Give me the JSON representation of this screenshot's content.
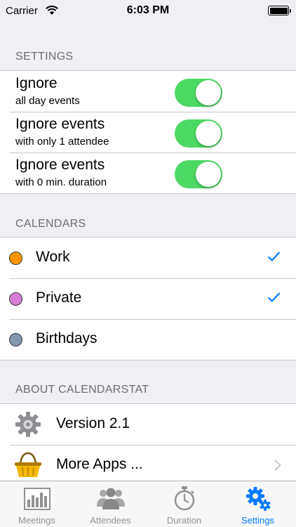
{
  "status_bar": {
    "carrier": "Carrier",
    "time": "6:03 PM"
  },
  "settings": {
    "header": "SETTINGS",
    "items": [
      {
        "title": "Ignore",
        "subtitle": "all day events",
        "on": true
      },
      {
        "title": "Ignore events",
        "subtitle": "with only 1 attendee",
        "on": true
      },
      {
        "title": "Ignore events",
        "subtitle": "with 0 min. duration",
        "on": true
      }
    ]
  },
  "calendars": {
    "header": "CALENDARS",
    "items": [
      {
        "label": "Work",
        "color": "#ff9500",
        "checked": true
      },
      {
        "label": "Private",
        "color": "#d97ed8",
        "checked": true
      },
      {
        "label": "Birthdays",
        "color": "#8497ad",
        "checked": false
      }
    ]
  },
  "about": {
    "header": "ABOUT CALENDARSTAT",
    "items": [
      {
        "label": "Version 2.1",
        "icon": "gear-icon"
      },
      {
        "label": "More Apps ...",
        "icon": "basket-icon"
      }
    ]
  },
  "tabs": [
    {
      "label": "Meetings",
      "icon": "bar-chart-icon",
      "active": false
    },
    {
      "label": "Attendees",
      "icon": "people-icon",
      "active": false
    },
    {
      "label": "Duration",
      "icon": "stopwatch-icon",
      "active": false
    },
    {
      "label": "Settings",
      "icon": "gears-icon",
      "active": true
    }
  ],
  "colors": {
    "accent": "#007aff",
    "switch_on": "#4cd964",
    "tab_inactive": "#929292"
  }
}
